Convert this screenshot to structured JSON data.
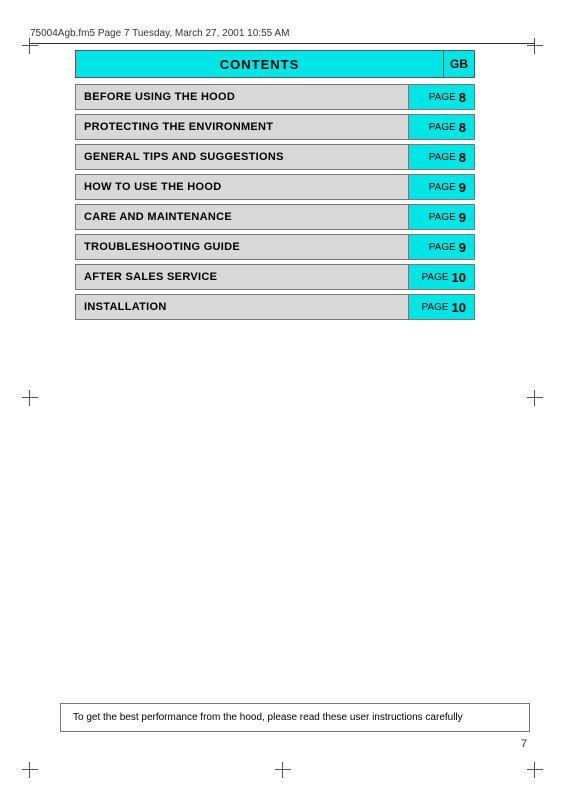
{
  "header": {
    "filename": "75004Agb.fm5  Page 7  Tuesday, March 27, 2001  10:55 AM"
  },
  "contents": {
    "title": "CONTENTS",
    "gb_label": "GB"
  },
  "toc_items": [
    {
      "label": "BEFORE USING THE HOOD",
      "page_word": "PAGE",
      "page_num": "8"
    },
    {
      "label": "PROTECTING THE ENVIRONMENT",
      "page_word": "PAGE",
      "page_num": "8"
    },
    {
      "label": "GENERAL TIPS AND SUGGESTIONS",
      "page_word": "PAGE",
      "page_num": "8"
    },
    {
      "label": "HOW TO USE THE HOOD",
      "page_word": "PAGE",
      "page_num": "9"
    },
    {
      "label": "CARE AND MAINTENANCE",
      "page_word": "PAGE",
      "page_num": "9"
    },
    {
      "label": "TROUBLESHOOTING GUIDE",
      "page_word": "PAGE",
      "page_num": "9"
    },
    {
      "label": "AFTER SALES SERVICE",
      "page_word": "PAGE",
      "page_num": "10"
    },
    {
      "label": "INSTALLATION",
      "page_word": "PAGE",
      "page_num": "10"
    }
  ],
  "bottom_note": "To get the best performance from the hood, please read these user instructions carefully",
  "page_number": "7"
}
